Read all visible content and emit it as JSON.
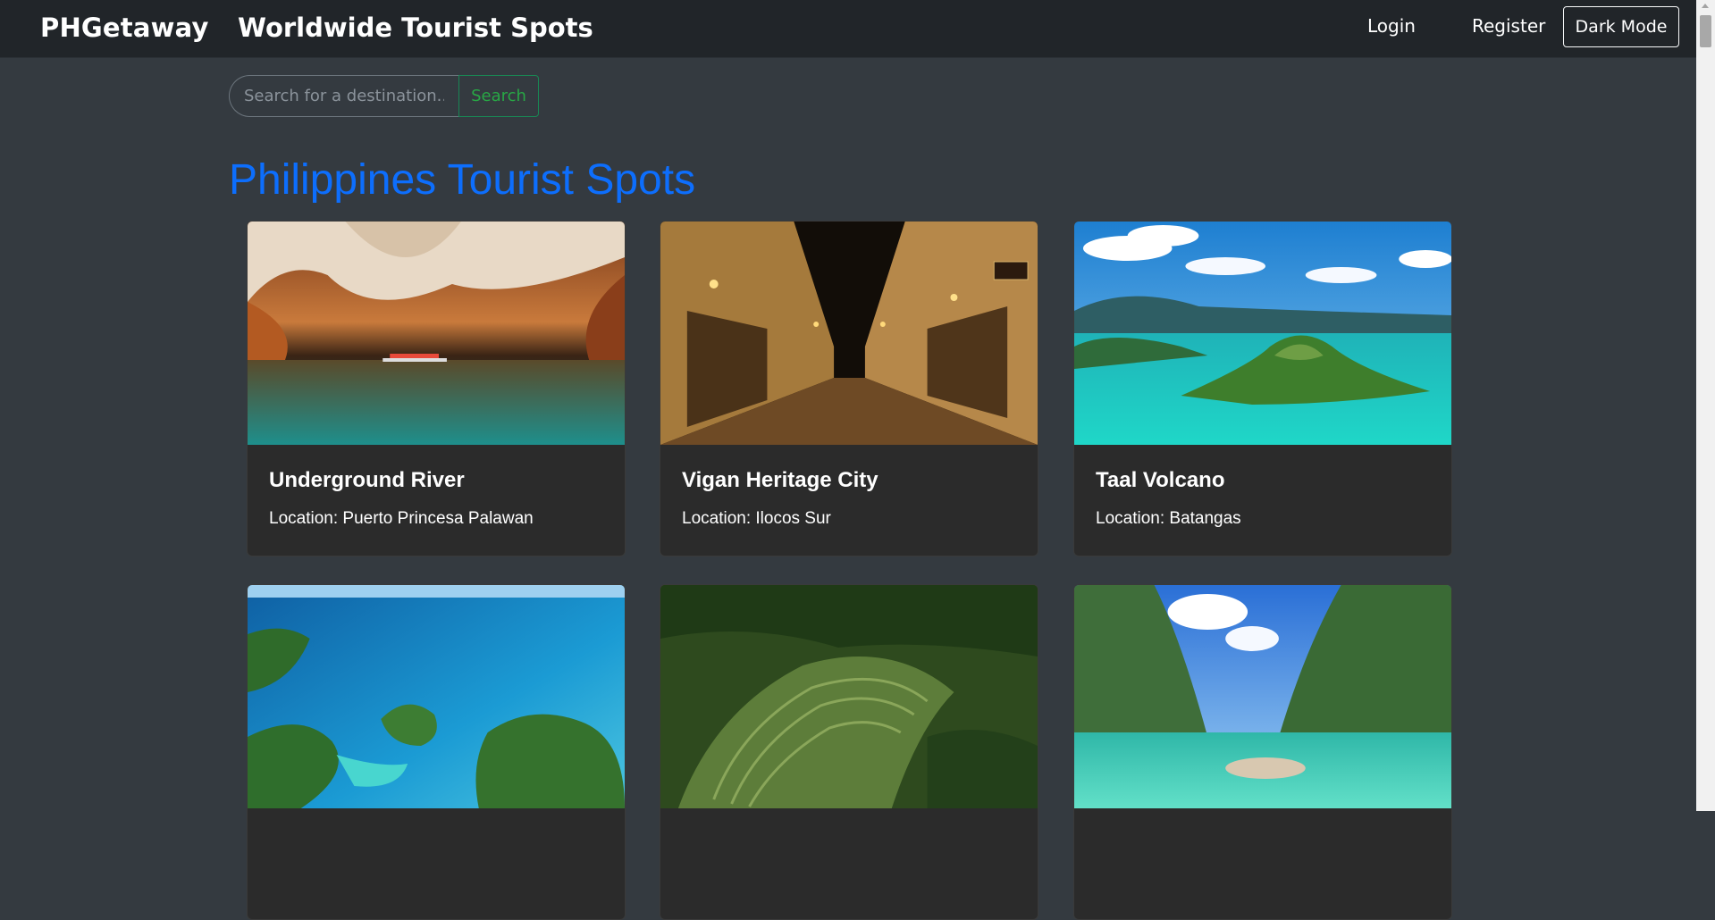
{
  "navbar": {
    "brand": "PHGetaway",
    "title": "Worldwide Tourist Spots",
    "login_label": "Login",
    "register_label": "Register",
    "dark_mode_label": "Dark Mode"
  },
  "search": {
    "placeholder": "Search for a destination...",
    "button_label": "Search"
  },
  "heading": "Philippines Tourist Spots",
  "cards": [
    {
      "title": "Underground River",
      "location": "Location: Puerto Princesa Palawan"
    },
    {
      "title": "Vigan Heritage City",
      "location": "Location: Ilocos Sur"
    },
    {
      "title": "Taal Volcano",
      "location": "Location: Batangas"
    },
    {
      "title": "",
      "location": ""
    },
    {
      "title": "",
      "location": ""
    },
    {
      "title": "",
      "location": ""
    }
  ],
  "colors": {
    "navbar_bg": "#212529",
    "page_bg": "#343a40",
    "heading": "#0d6efd",
    "search_accent": "#198754",
    "card_bg": "#2b2b2b"
  }
}
